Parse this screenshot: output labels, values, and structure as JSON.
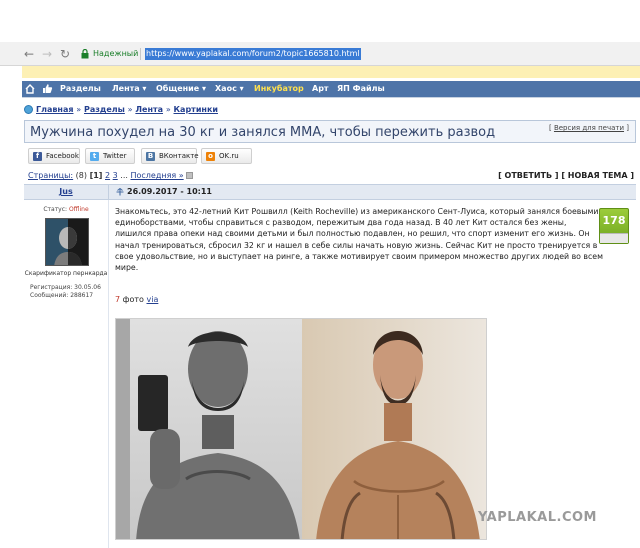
{
  "browser": {
    "secure_label": "Надежный",
    "url": "https://www.yaplakal.com/forum2/topic1665810.html"
  },
  "site_nav": {
    "items": [
      {
        "label": "Разделы",
        "highlight": false
      },
      {
        "label": "Лента ▾",
        "highlight": false
      },
      {
        "label": "Общение ▾",
        "highlight": false
      },
      {
        "label": "Хаос ▾",
        "highlight": false
      },
      {
        "label": "Инкубатор",
        "highlight": true
      },
      {
        "label": "Арт",
        "highlight": false
      },
      {
        "label": "ЯП Файлы",
        "highlight": false
      }
    ],
    "bg_color": "#4e74a8",
    "highlight_color": "#ffe14d"
  },
  "breadcrumb": {
    "items": [
      "Главная",
      "Разделы",
      "Лента",
      "Картинки"
    ],
    "separator": "»"
  },
  "topic": {
    "title": "Мужчина похудел на 30 кг и занялся ММА, чтобы пережить развод",
    "print_open": "[",
    "print_link": "Версия для печати",
    "print_close": "]"
  },
  "share": {
    "facebook": "Facebook",
    "twitter": "Twitter",
    "vk": "ВКонтакте",
    "ok": "OK.ru"
  },
  "pages": {
    "label": "Страницы:",
    "count": "(8)",
    "current": "[1]",
    "p2": "2",
    "p3": "3",
    "dots": "...",
    "last": "Последняя »"
  },
  "actions": {
    "reply": "[ ОТВЕТИТЬ ]",
    "new_topic": "[ НОВАЯ ТЕМА ]"
  },
  "post": {
    "author": "Jus",
    "date": "26.09.2017 - 10:11",
    "status_label": "Статус:",
    "status_value": "Offline",
    "rank": "Скарификатор пернкарда",
    "reg_line": "Регистрация: 30.05.06",
    "msgs_line": "Сообщений: 288617",
    "body": "Знакомьтесь, это 42-летний Кит Рошвилл (Keith Rocheville) из американского Сент-Луиса, который занялся боевыми единоборствами, чтобы справиться с разводом, пережитым два года назад. В 40 лет Кит остался без жены, лишился права опеки над своими детьми и был полностью подавлен, но решил, что спорт изменит его жизнь. Он начал тренироваться, сбросил 32 кг и нашел в себе силы начать новую жизнь. Сейчас Кит не просто тренируется в свое удовольствие, но и выступает на ринге, а также мотивирует своим примером множество других людей во всем мире.",
    "rating": "178",
    "photo_count": "7",
    "photo_word": "фото",
    "via": "via"
  },
  "watermark": "YAPLAKAL.COM",
  "icons": {
    "back": "arrow-left-icon",
    "forward": "arrow-right-icon",
    "reload": "reload-icon",
    "lock": "lock-icon",
    "home": "home-icon",
    "like": "thumbs-up-icon",
    "date": "post-link-icon"
  }
}
